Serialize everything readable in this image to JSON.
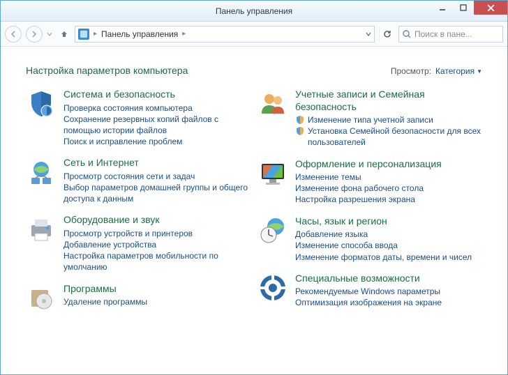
{
  "window": {
    "title": "Панель управления"
  },
  "breadcrumb": {
    "location": "Панель управления"
  },
  "search": {
    "placeholder": "Поиск в пане..."
  },
  "header": {
    "title": "Настройка параметров компьютера",
    "view_label": "Просмотр:",
    "view_value": "Категория"
  },
  "categories": {
    "left": [
      {
        "title": "Система и безопасность",
        "links": [
          "Проверка состояния компьютера",
          "Сохранение резервных копий файлов с помощью истории файлов",
          "Поиск и исправление проблем"
        ]
      },
      {
        "title": "Сеть и Интернет",
        "links": [
          "Просмотр состояния сети и задач",
          "Выбор параметров домашней группы и общего доступа к данным"
        ]
      },
      {
        "title": "Оборудование и звук",
        "links": [
          "Просмотр устройств и принтеров",
          "Добавление устройства",
          "Настройка параметров мобильности по умолчанию"
        ]
      },
      {
        "title": "Программы",
        "links": [
          "Удаление программы"
        ]
      }
    ],
    "right": [
      {
        "title": "Учетные записи и Семейная безопасность",
        "iconlinks": [
          "Изменение типа учетной записи",
          "Установка Семейной безопасности для всех пользователей"
        ]
      },
      {
        "title": "Оформление и персонализация",
        "links": [
          "Изменение темы",
          "Изменение фона рабочего стола",
          "Настройка разрешения экрана"
        ]
      },
      {
        "title": "Часы, язык и регион",
        "links": [
          "Добавление языка",
          "Изменение способа ввода",
          "Изменение форматов даты, времени и чисел"
        ]
      },
      {
        "title": "Специальные возможности",
        "links": [
          "Рекомендуемые Windows параметры",
          "Оптимизация изображения на экране"
        ]
      }
    ]
  }
}
